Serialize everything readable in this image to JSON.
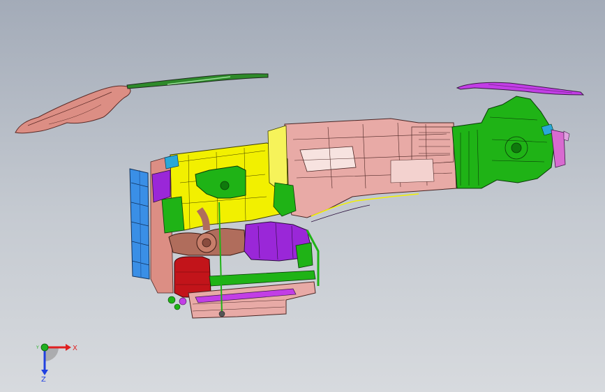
{
  "viewport": {
    "background_top": "#a3abb8",
    "background_bottom": "#d7dade"
  },
  "model": {
    "part_colors": {
      "housing": "#e8aaa6",
      "engine_block": "#f2f000",
      "transfer_case": "#1fb316",
      "radiator": "#3a8fe6",
      "manifold": "#9a27d8",
      "filter": "#c2141a",
      "cover_left": "#dc8e84",
      "shield_right": "#c23ee6"
    }
  },
  "triad": {
    "x_label": "X",
    "y_label": "Y",
    "z_label": "Z",
    "x_color": "#e02020",
    "y_color": "#20b020",
    "z_color": "#2040e0"
  }
}
